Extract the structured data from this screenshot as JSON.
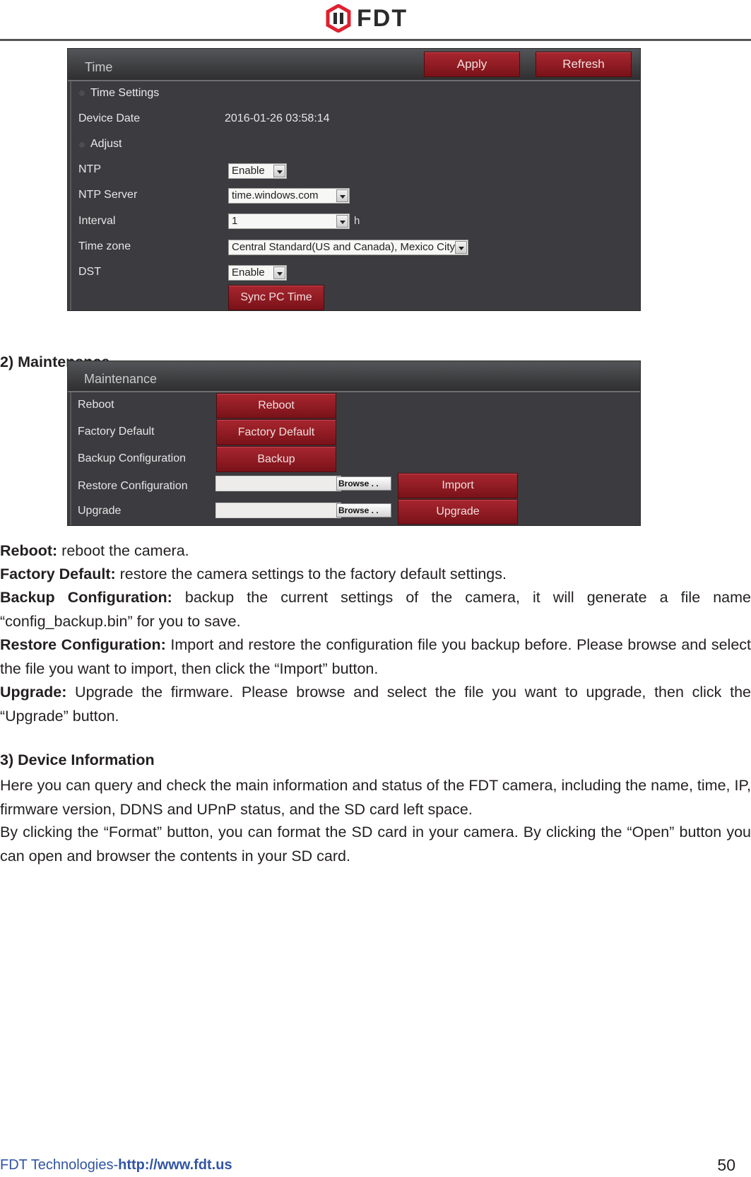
{
  "header": {
    "brand": "FDT",
    "logo_colors": {
      "hexagon": "#e0202f",
      "text": "#2b2b2b"
    }
  },
  "time_panel": {
    "title": "Time",
    "apply_label": "Apply",
    "refresh_label": "Refresh",
    "sections": {
      "time_settings": "Time Settings",
      "adjust": "Adjust"
    },
    "device_date_label": "Device Date",
    "device_date_value": "2016-01-26 03:58:14",
    "ntp": {
      "label": "NTP",
      "value": "Enable"
    },
    "ntp_server": {
      "label": "NTP Server",
      "value": "time.windows.com"
    },
    "interval": {
      "label": "Interval",
      "value": "1",
      "unit": "h"
    },
    "time_zone": {
      "label": "Time zone",
      "value": "Central Standard(US and Canada), Mexico City"
    },
    "dst": {
      "label": "DST",
      "value": "Enable"
    },
    "sync_label": "Sync PC Time"
  },
  "maintenance_heading": "2) Maintenance",
  "maintenance_panel": {
    "title": "Maintenance",
    "rows": {
      "reboot": {
        "label": "Reboot",
        "button": "Reboot"
      },
      "factory_default": {
        "label": "Factory Default",
        "button": "Factory Default"
      },
      "backup": {
        "label": "Backup Configuration",
        "button": "Backup"
      },
      "restore": {
        "label": "Restore Configuration",
        "browse": "Browse . .",
        "button": "Import"
      },
      "upgrade": {
        "label": "Upgrade",
        "browse": "Browse . .",
        "button": "Upgrade"
      }
    }
  },
  "descriptions": {
    "reboot": {
      "term": "Reboot:",
      "text": " reboot the camera."
    },
    "factory_default": {
      "term": "Factory Default:",
      "text": " restore the camera settings to the factory default settings."
    },
    "backup": {
      "term": "Backup Configuration:",
      "text": " backup the current settings of the camera, it will generate a file name “config_backup.bin” for you to save."
    },
    "restore": {
      "term": "Restore Configuration:",
      "text": " Import and restore the configuration file you backup before. Please browse and select the file you want to import, then click the “Import” button."
    },
    "upgrade": {
      "term": "Upgrade:",
      "text": " Upgrade the firmware. Please browse and select the file you want to upgrade, then click the “Upgrade” button."
    }
  },
  "device_info": {
    "heading": "3) Device Information",
    "paragraph1": "Here you can query and check the main information and status of the FDT camera, including the name, time, IP, firmware version, DDNS and UPnP status, and the SD card left space.",
    "paragraph2": "By clicking the “Format” button, you can format the SD card in your camera. By clicking the “Open” button you can open and browser the contents in your SD card."
  },
  "footer": {
    "company": "FDT Technologies-",
    "url": "http://www.fdt.us",
    "page_number": "50"
  }
}
